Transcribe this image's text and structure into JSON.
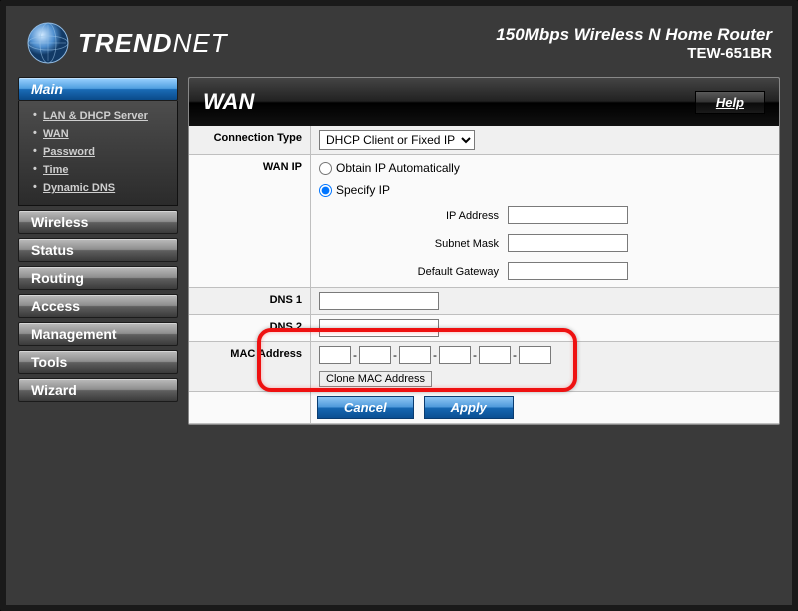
{
  "header": {
    "brand": "TRENDNET",
    "title": "150Mbps Wireless N Home Router",
    "model": "TEW-651BR"
  },
  "sidebar": {
    "active": "Main",
    "sections": [
      {
        "label": "Main",
        "items": [
          "LAN & DHCP Server",
          "WAN",
          "Password",
          "Time",
          "Dynamic DNS"
        ]
      },
      {
        "label": "Wireless"
      },
      {
        "label": "Status"
      },
      {
        "label": "Routing"
      },
      {
        "label": "Access"
      },
      {
        "label": "Management"
      },
      {
        "label": "Tools"
      },
      {
        "label": "Wizard"
      }
    ]
  },
  "page": {
    "title": "WAN",
    "help": "Help"
  },
  "form": {
    "connection_type_label": "Connection Type",
    "connection_type_value": "DHCP Client or Fixed IP",
    "wan_ip_label": "WAN IP",
    "obtain_label": "Obtain IP Automatically",
    "specify_label": "Specify IP",
    "wan_ip_mode": "specify",
    "ip_address_label": "IP Address",
    "ip_address": "",
    "subnet_label": "Subnet Mask",
    "subnet": "",
    "gateway_label": "Default Gateway",
    "gateway": "",
    "dns1_label": "DNS 1",
    "dns1": "",
    "dns2_label": "DNS 2",
    "dns2": "",
    "mac_label": "MAC Address",
    "mac": [
      "",
      "",
      "",
      "",
      "",
      ""
    ],
    "clone_label": "Clone MAC Address",
    "cancel": "Cancel",
    "apply": "Apply"
  }
}
